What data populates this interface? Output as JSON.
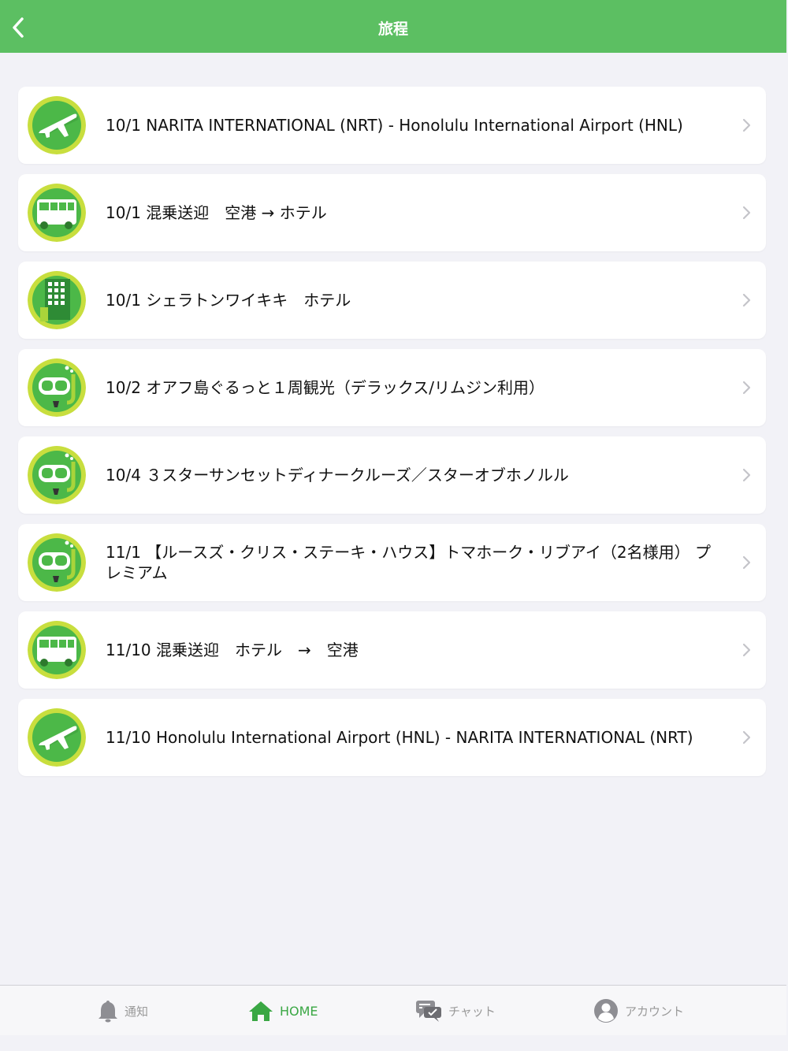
{
  "header": {
    "title": "旅程"
  },
  "itinerary": [
    {
      "type": "flight",
      "label": "10/1 NARITA INTERNATIONAL (NRT) - Honolulu International Airport (HNL)"
    },
    {
      "type": "bus",
      "label": "10/1 混乗送迎　空港 → ホテル"
    },
    {
      "type": "hotel",
      "label": "10/1 シェラトンワイキキ　ホテル"
    },
    {
      "type": "activity",
      "label": "10/2 オアフ島ぐるっと１周観光（デラックス/リムジン利用）"
    },
    {
      "type": "activity",
      "label": "10/4 ３スターサンセットディナークルーズ／スターオブホノルル"
    },
    {
      "type": "activity",
      "label": "11/1 【ルースズ・クリス・ステーキ・ハウス】トマホーク・リブアイ（2名様用） プレミアム"
    },
    {
      "type": "bus",
      "label": "11/10 混乗送迎　ホテル　→　空港"
    },
    {
      "type": "flight",
      "label": "11/10 Honolulu International Airport (HNL) - NARITA INTERNATIONAL (NRT)"
    }
  ],
  "tabbar": {
    "notifications": "通知",
    "home": "HOME",
    "chat": "チャット",
    "account": "アカウント"
  },
  "colors": {
    "header": "#5cbf62",
    "icon_ring": "#c8de3e",
    "icon_fill": "#4cb848",
    "active_tab": "#3aa744"
  }
}
